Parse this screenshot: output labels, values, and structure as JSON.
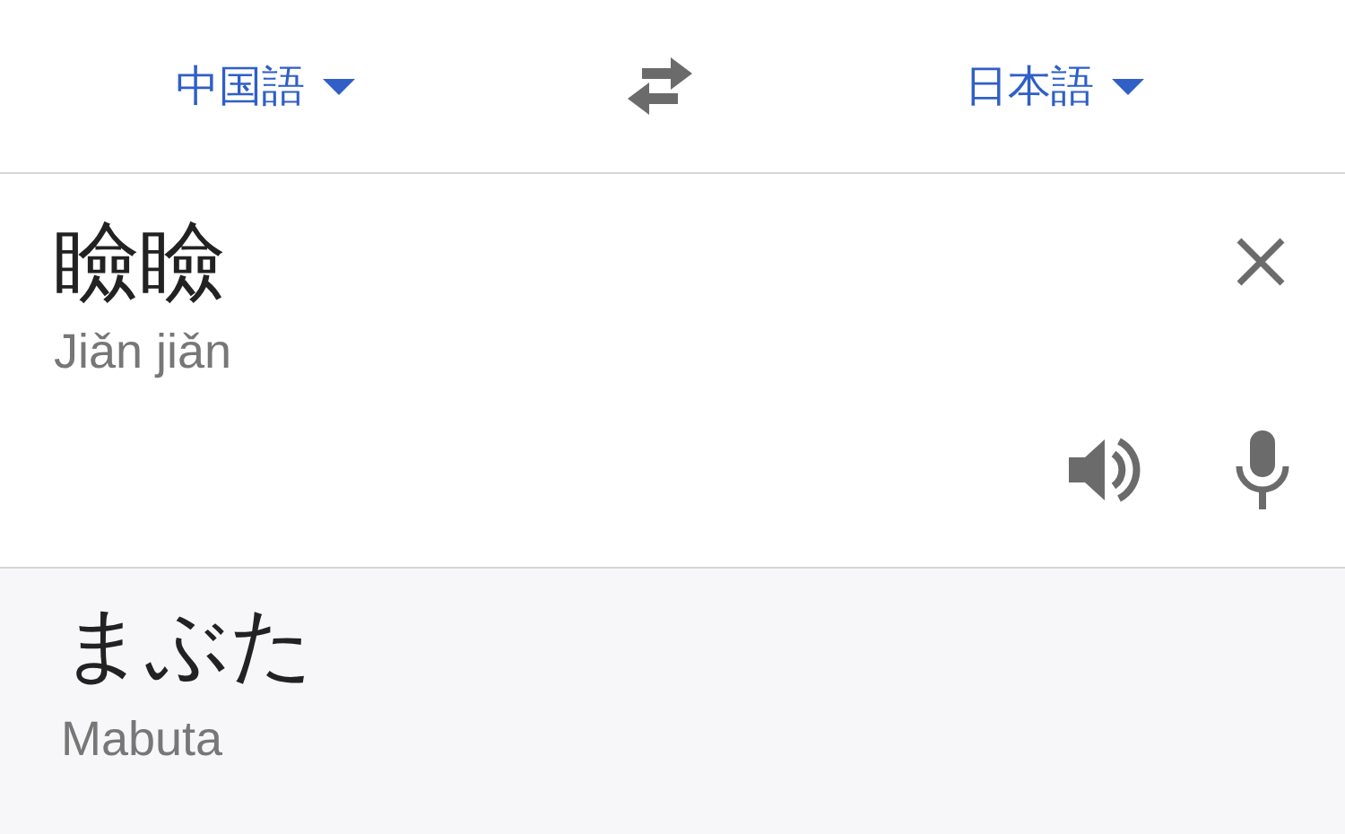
{
  "languages": {
    "source": "中国語",
    "target": "日本語"
  },
  "input": {
    "text": "瞼瞼",
    "romanization": "Jiǎn jiǎn"
  },
  "translation": {
    "text": "まぶた",
    "romanization": "Mabuta"
  }
}
